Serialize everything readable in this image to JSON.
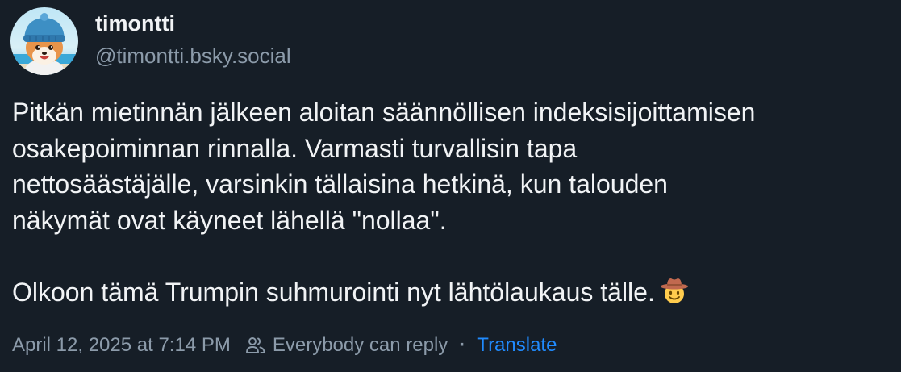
{
  "author": {
    "display_name": "timontti",
    "handle": "@timontti.bsky.social",
    "avatar_icon": "shiba-dog-beanie-avatar"
  },
  "post": {
    "lines": [
      "Pitkän mietinnän jälkeen aloitan säännöllisen indeksisijoittamisen",
      "osakepoiminnan rinnalla. Varmasti turvallisin tapa",
      "nettosäästäjälle, varsinkin tällaisina hetkinä, kun talouden",
      "näkymät ovat käyneet lähellä \"nollaa\"."
    ],
    "last_line": "Olkoon tämä Trumpin suhmurointi nyt lähtölaukaus tälle.",
    "emoji": "cowboy-hat-face-emoji"
  },
  "footer": {
    "timestamp": "April 12, 2025 at 7:14 PM",
    "reply_setting": "Everybody can reply",
    "separator": "·",
    "translate_label": "Translate"
  },
  "colors": {
    "background": "#161e27",
    "text": "#f1f3f5",
    "muted": "#8c9baa",
    "link": "#208bfe"
  }
}
